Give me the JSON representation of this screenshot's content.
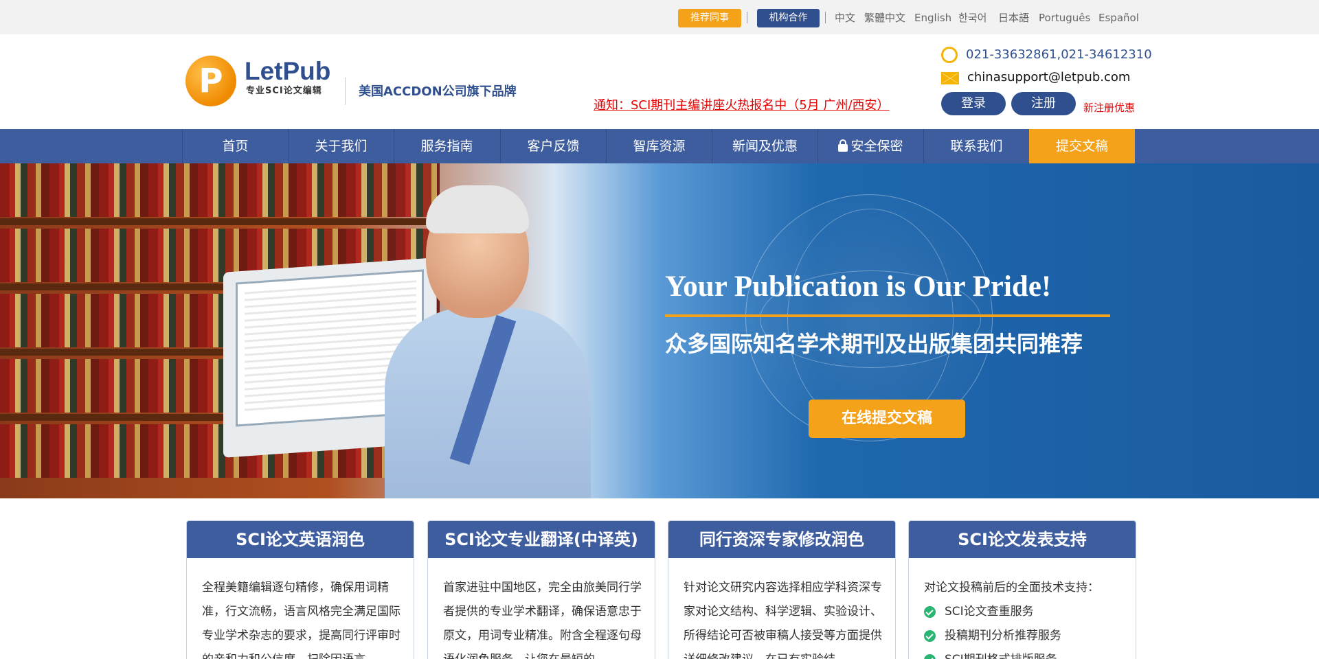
{
  "topbar": {
    "recommend_label": "推荐同事",
    "org_label": "机构合作",
    "languages": [
      "中文",
      "繁體中文",
      "English",
      "한국어",
      "日本語",
      "Português",
      "Español"
    ]
  },
  "header": {
    "logo_letter": "P",
    "logo_name": "LetPub",
    "logo_sub": "专业SCI论文编辑",
    "brand_tag": "美国ACCDON公司旗下品牌",
    "notice": "通知：SCI期刊主编讲座火热报名中（5月 广州/西安）",
    "phone": "021-33632861,021-34612310",
    "email": "chinasupport@letpub.com",
    "login_label": "登录",
    "register_label": "注册",
    "register_promo": "新注册优惠"
  },
  "nav": {
    "items": [
      "首页",
      "关于我们",
      "服务指南",
      "客户反馈",
      "智库资源",
      "新闻及优惠",
      "安全保密",
      "联系我们",
      "提交文稿"
    ]
  },
  "hero": {
    "headline": "Your Publication is Our Pride!",
    "subline": "众多国际知名学术期刊及出版集团共同推荐",
    "cta_label": "在线提交文稿"
  },
  "cards": [
    {
      "title": "SCI论文英语润色",
      "body": "全程美籍编辑逐句精修，确保用词精准，行文流畅，语言风格完全满足国际专业学术杂志的要求，提高同行评审时的亲和力和公信度，扫除因语言"
    },
    {
      "title": "SCI论文专业翻译(中译英)",
      "body": "首家进驻中国地区，完全由旅美同行学者提供的专业学术翻译，确保语意忠于原文，用词专业精准。附含全程逐句母语化润色服务，让您在最短的"
    },
    {
      "title": "同行资深专家修改润色",
      "body": "针对论文研究内容选择相应学科资深专家对论文结构、科学逻辑、实验设计、所得结论可否被审稿人接受等方面提供详细修改建议，在已有实验结"
    },
    {
      "title": "SCI论文发表支持",
      "intro": "对论文投稿前后的全面技术支持：",
      "items": [
        "SCI论文查重服务",
        "投稿期刊分析推荐服务",
        "SCI期刊格式排版服务"
      ]
    }
  ]
}
